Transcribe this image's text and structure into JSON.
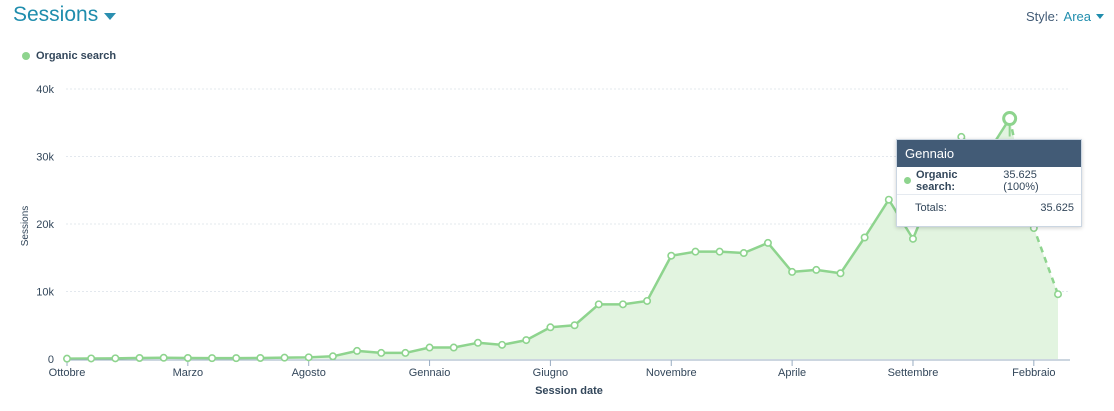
{
  "header": {
    "title": "Sessions",
    "style_label": "Style:",
    "style_value": "Area"
  },
  "legend": {
    "label": "Organic search"
  },
  "colors": {
    "series": "#8ed48e",
    "series_fill": "#e2f4e0",
    "accent": "#1f8dad",
    "axis": "#425b76"
  },
  "tooltip": {
    "title": "Gennaio",
    "series_label": "Organic search:",
    "series_value": "35.625 (100%)",
    "total_label": "Totals:",
    "total_value": "35.625"
  },
  "chart_data": {
    "type": "area",
    "xlabel": "Session date",
    "ylabel": "Sessions",
    "ylim": [
      0,
      40000
    ],
    "y_ticks": [
      "0",
      "10k",
      "20k",
      "30k",
      "40k"
    ],
    "x_tick_labels": [
      {
        "index": 0,
        "label": "Ottobre"
      },
      {
        "index": 5,
        "label": "Marzo"
      },
      {
        "index": 10,
        "label": "Agosto"
      },
      {
        "index": 15,
        "label": "Gennaio"
      },
      {
        "index": 20,
        "label": "Giugno"
      },
      {
        "index": 25,
        "label": "Novembre"
      },
      {
        "index": 30,
        "label": "Aprile"
      },
      {
        "index": 35,
        "label": "Settembre"
      },
      {
        "index": 40,
        "label": "Febbraio"
      }
    ],
    "series": [
      {
        "name": "Organic search",
        "values": [
          50,
          80,
          100,
          150,
          180,
          150,
          130,
          130,
          150,
          200,
          250,
          400,
          1200,
          900,
          900,
          1700,
          1700,
          2400,
          2100,
          2800,
          4700,
          5000,
          8100,
          8100,
          8600,
          15300,
          15900,
          15900,
          15700,
          17200,
          12900,
          13200,
          12700,
          18000,
          23600,
          17800,
          26500,
          32900,
          30000,
          35625,
          19400,
          9600
        ],
        "dashed_from_index": 39
      }
    ],
    "highlight_index": 39,
    "grid": true
  }
}
